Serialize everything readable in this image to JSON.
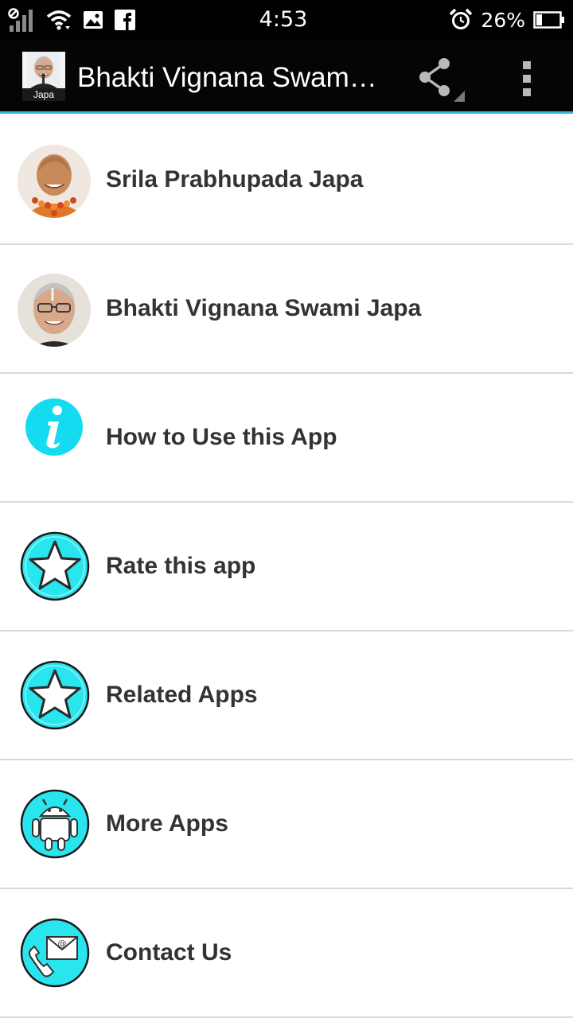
{
  "status_bar": {
    "time": "4:53",
    "battery_percent": "26%",
    "icons": [
      "signal-icon",
      "wifi-icon",
      "gallery-notification-icon",
      "facebook-notification-icon",
      "alarm-icon",
      "battery-icon"
    ],
    "battery_level": 0.26
  },
  "action_bar": {
    "title": "Bhakti Vignana Swam…",
    "app_icon_label": "Japa",
    "share_icon": "share-icon",
    "overflow_icon": "overflow-menu-icon",
    "accent_color": "#33b5e5"
  },
  "menu": {
    "items": [
      {
        "label": "Srila Prabhupada Japa",
        "icon": "prabhupada-photo-icon"
      },
      {
        "label": "Bhakti Vignana Swami Japa",
        "icon": "bhakti-vignana-swami-photo-icon"
      },
      {
        "label": "How to Use this App",
        "icon": "info-icon"
      },
      {
        "label": "Rate this app",
        "icon": "star-icon"
      },
      {
        "label": "Related Apps",
        "icon": "star-icon"
      },
      {
        "label": "More Apps",
        "icon": "android-icon"
      },
      {
        "label": "Contact Us",
        "icon": "contact-icon"
      }
    ],
    "icon_color": "#29e6ee",
    "divider_color": "#d9d9d9",
    "text_color": "#333333"
  }
}
